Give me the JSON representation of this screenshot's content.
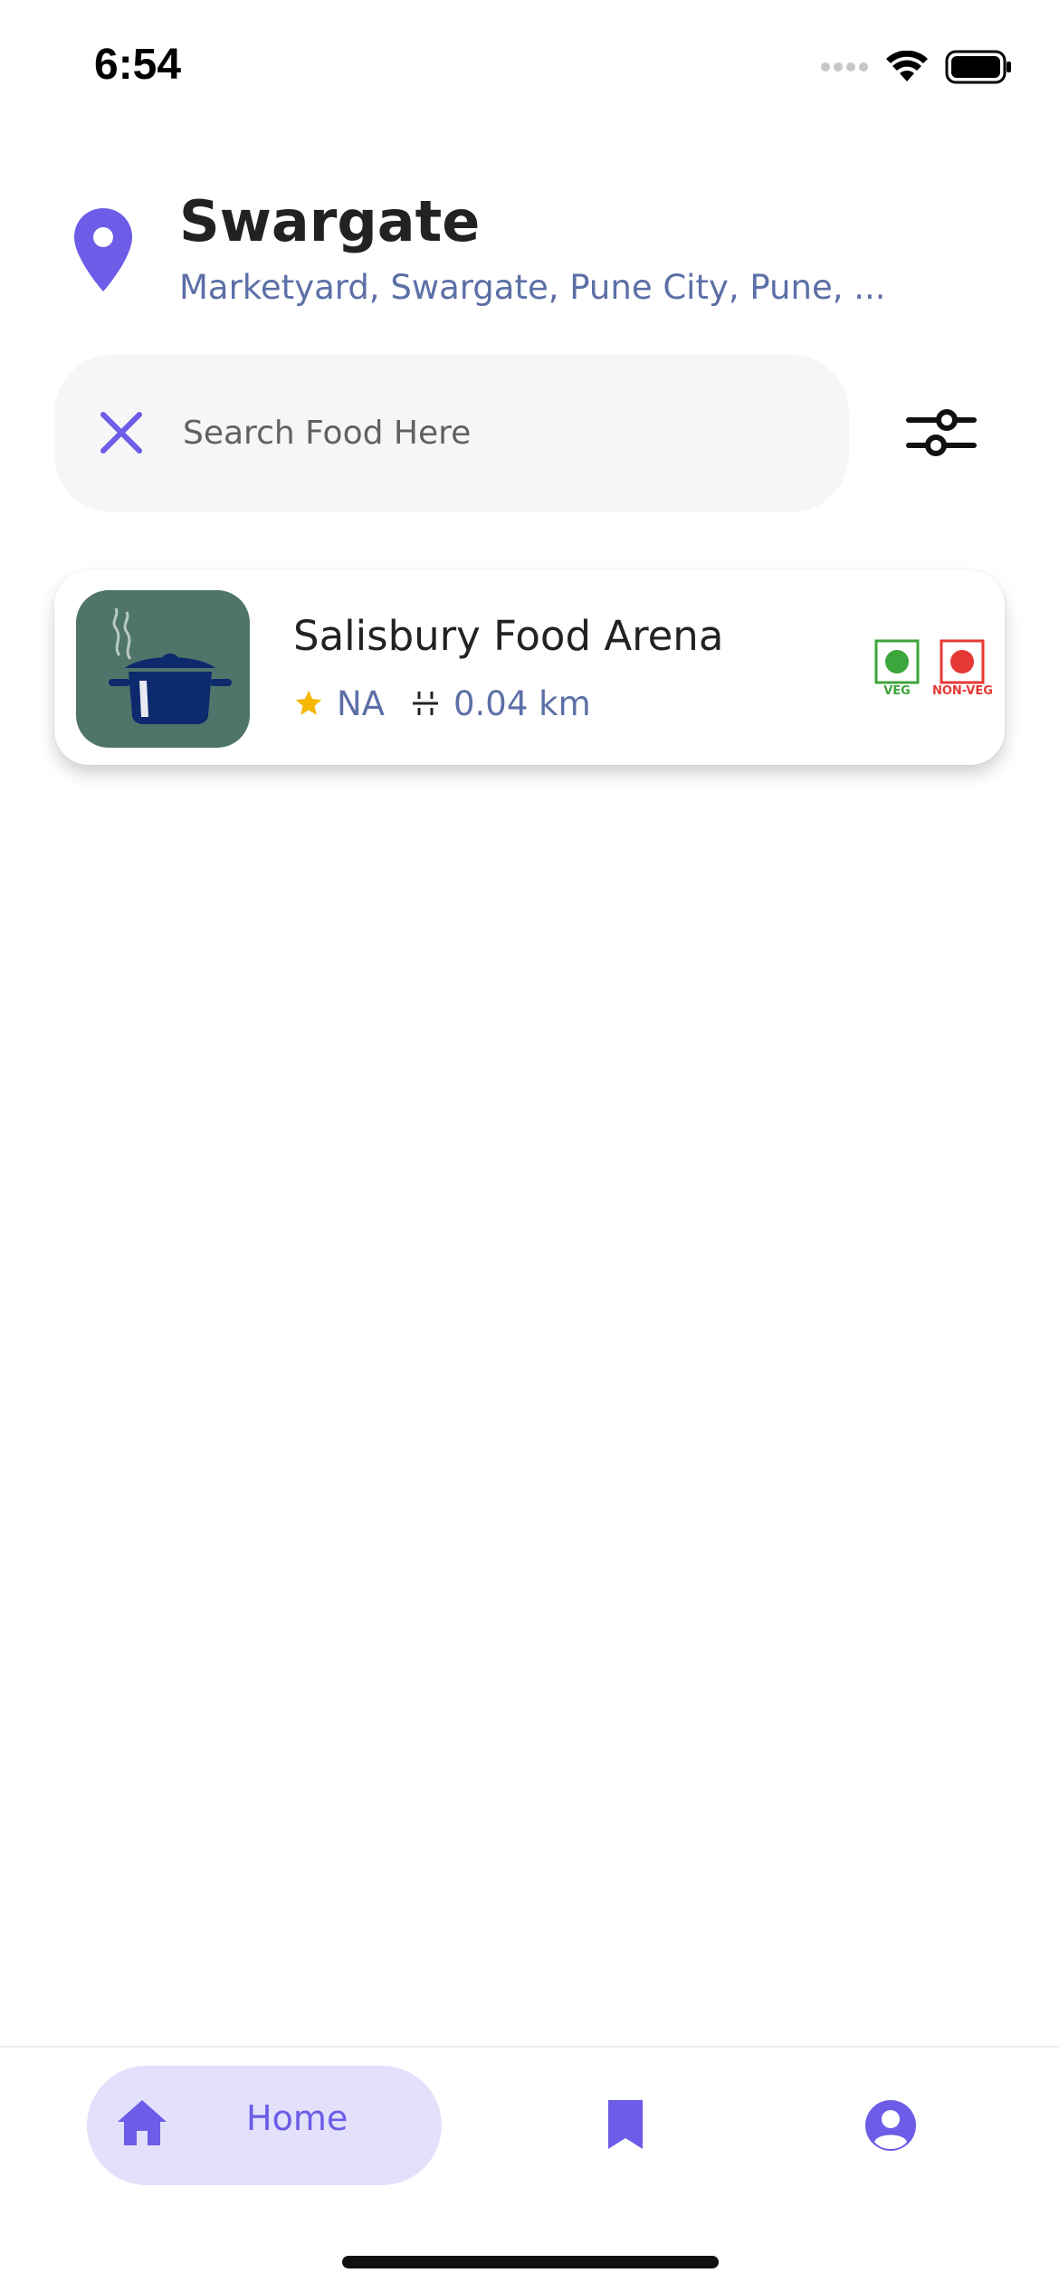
{
  "status_bar": {
    "time": "6:54"
  },
  "location": {
    "title": "Swargate",
    "subtitle": "Marketyard, Swargate, Pune City, Pune, ...",
    "pin_icon": "location-pin-icon"
  },
  "search": {
    "placeholder": "Search Food Here",
    "value": "",
    "clear_icon": "close-icon",
    "filter_icon": "sliders-icon"
  },
  "results": [
    {
      "name": "Salisbury Food Arena",
      "rating": "NA",
      "distance": "0.04 km",
      "veg_label": "VEG",
      "nonveg_label": "NON-VEG"
    }
  ],
  "bottom_nav": {
    "home_label": "Home",
    "items": [
      "home-icon",
      "bookmark-icon",
      "profile-icon"
    ]
  },
  "colors": {
    "accent": "#6c5ce7",
    "subtitle": "#5c6fa6",
    "veg": "#3ca53c",
    "nonveg": "#e53935",
    "star": "#f5b700",
    "nav_active_bg": "#e3e0fb"
  }
}
